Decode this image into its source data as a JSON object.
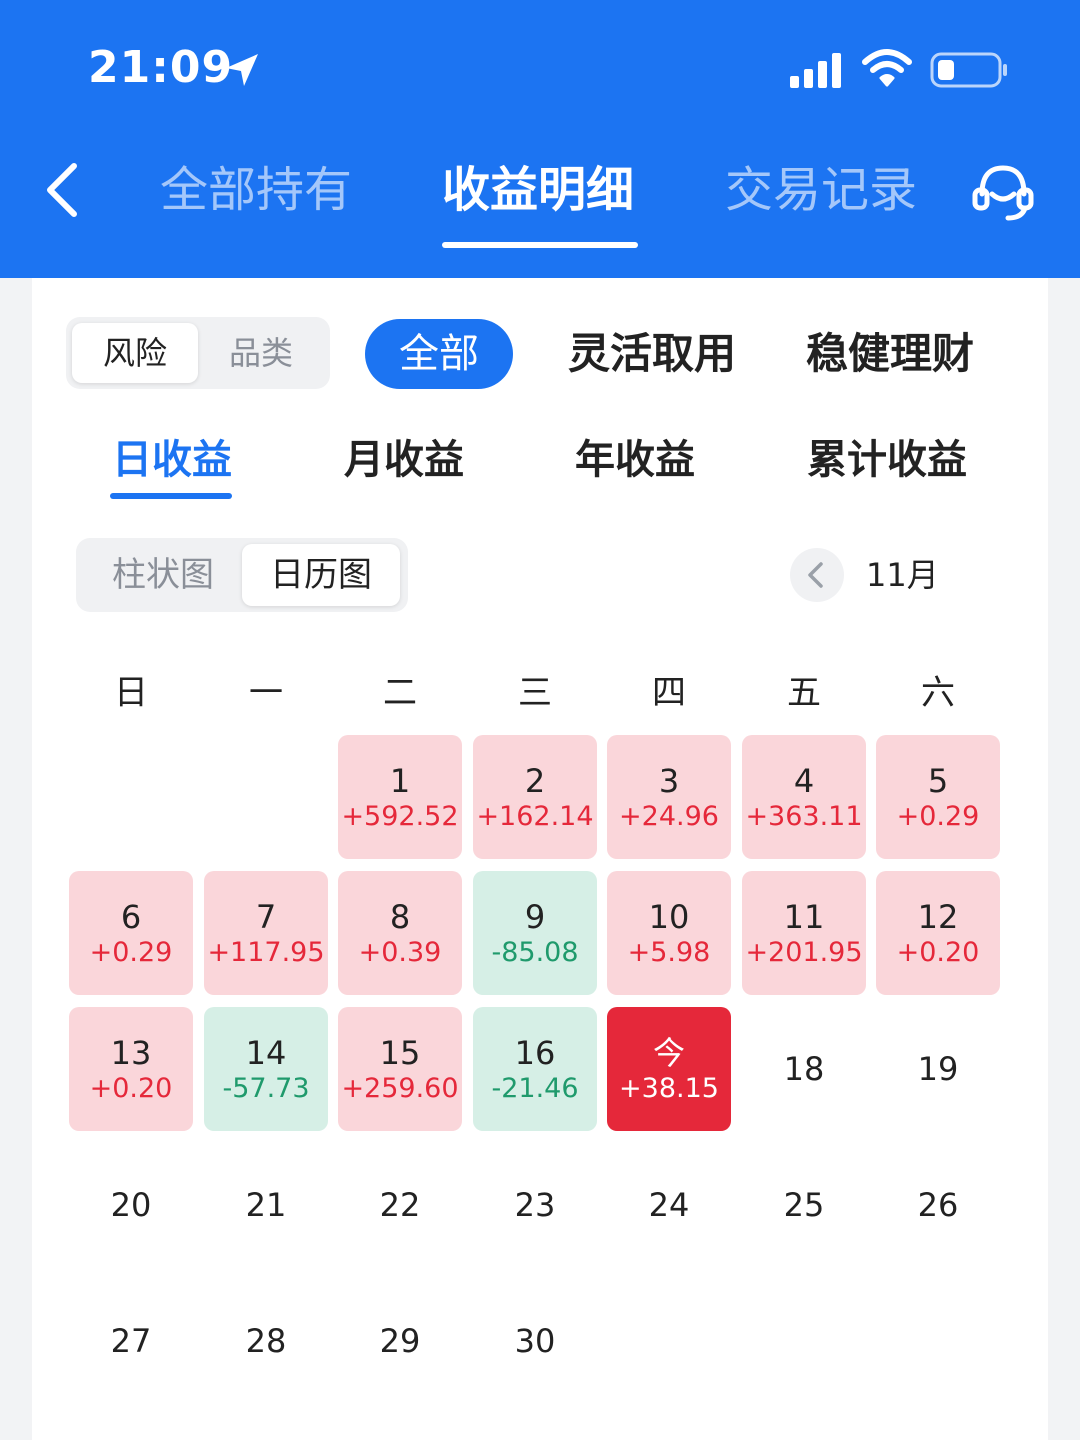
{
  "status_bar": {
    "time": "21:09"
  },
  "nav": {
    "tabs": [
      {
        "label": "全部持有"
      },
      {
        "label": "收益明细"
      },
      {
        "label": "交易记录"
      }
    ]
  },
  "filters": {
    "group_toggle": [
      "风险",
      "品类"
    ],
    "categories": [
      "全部",
      "灵活取用",
      "稳健理财"
    ]
  },
  "period_tabs": [
    "日收益",
    "月收益",
    "年收益",
    "累计收益"
  ],
  "view_toggle": [
    "柱状图",
    "日历图"
  ],
  "month": "11月",
  "weekdays": [
    "日",
    "一",
    "二",
    "三",
    "四",
    "五",
    "六"
  ],
  "colors": {
    "brand": "#1c74f2",
    "profit": "#e5283a",
    "loss": "#1f9a6c",
    "profit_bg": "#fad6da",
    "loss_bg": "#d6efe6"
  },
  "calendar": [
    {
      "day": "1",
      "value": "+592.52",
      "type": "profit"
    },
    {
      "day": "2",
      "value": "+162.14",
      "type": "profit"
    },
    {
      "day": "3",
      "value": "+24.96",
      "type": "profit"
    },
    {
      "day": "4",
      "value": "+363.11",
      "type": "profit"
    },
    {
      "day": "5",
      "value": "+0.29",
      "type": "profit"
    },
    {
      "day": "6",
      "value": "+0.29",
      "type": "profit"
    },
    {
      "day": "7",
      "value": "+117.95",
      "type": "profit"
    },
    {
      "day": "8",
      "value": "+0.39",
      "type": "profit"
    },
    {
      "day": "9",
      "value": "-85.08",
      "type": "loss"
    },
    {
      "day": "10",
      "value": "+5.98",
      "type": "profit"
    },
    {
      "day": "11",
      "value": "+201.95",
      "type": "profit"
    },
    {
      "day": "12",
      "value": "+0.20",
      "type": "profit"
    },
    {
      "day": "13",
      "value": "+0.20",
      "type": "profit"
    },
    {
      "day": "14",
      "value": "-57.73",
      "type": "loss"
    },
    {
      "day": "15",
      "value": "+259.60",
      "type": "profit"
    },
    {
      "day": "16",
      "value": "-21.46",
      "type": "loss"
    },
    {
      "day": "今",
      "value": "+38.15",
      "type": "today"
    },
    {
      "day": "18",
      "value": "",
      "type": "plain"
    },
    {
      "day": "19",
      "value": "",
      "type": "plain"
    },
    {
      "day": "20",
      "value": "",
      "type": "plain"
    },
    {
      "day": "21",
      "value": "",
      "type": "plain"
    },
    {
      "day": "22",
      "value": "",
      "type": "plain"
    },
    {
      "day": "23",
      "value": "",
      "type": "plain"
    },
    {
      "day": "24",
      "value": "",
      "type": "plain"
    },
    {
      "day": "25",
      "value": "",
      "type": "plain"
    },
    {
      "day": "26",
      "value": "",
      "type": "plain"
    },
    {
      "day": "27",
      "value": "",
      "type": "plain"
    },
    {
      "day": "28",
      "value": "",
      "type": "plain"
    },
    {
      "day": "29",
      "value": "",
      "type": "plain"
    },
    {
      "day": "30",
      "value": "",
      "type": "plain"
    }
  ]
}
